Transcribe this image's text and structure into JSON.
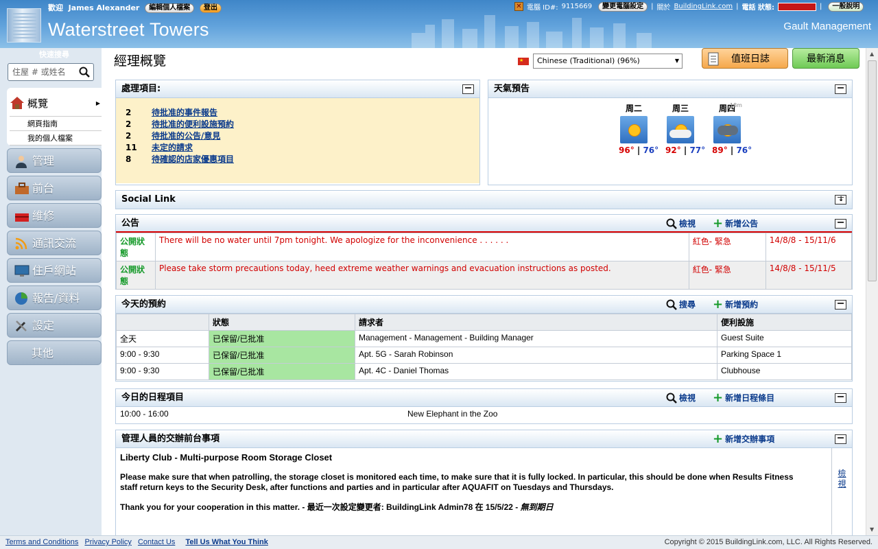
{
  "header": {
    "welcome": "歡迎",
    "user_name": "James Alexander",
    "edit_profile": "編輯個人檔案",
    "logout": "登出",
    "computer_label": "電腦 ID#:",
    "computer_id": "9115669",
    "change_computer": "變更電腦設定",
    "about_prefix": "關於",
    "about_link": "BuildingLink.com",
    "phone_status": "電話 狀態:",
    "general_help": "一般說明",
    "site_title": "Waterstreet Towers",
    "management": "Gault Management"
  },
  "sidebar": {
    "quick_search_label": "快速搜尋",
    "search_placeholder": "住屋 # 或姓名",
    "active_item": "概覽",
    "active_sub": [
      "網頁指南",
      "我的個人檔案"
    ],
    "items": [
      "管理",
      "前台",
      "維修",
      "通訊交流",
      "住戶網站",
      "報告/資料",
      "設定",
      "其他"
    ]
  },
  "main": {
    "page_title": "經理概覽",
    "language": "Chinese (Traditional) (96%)",
    "duty_log": "值班日誌",
    "latest_news": "最新消息"
  },
  "todo": {
    "title": "處理項目:",
    "items": [
      {
        "count": "2",
        "label": "待批准的事件報告"
      },
      {
        "count": "2",
        "label": "待批准的便利設施預約"
      },
      {
        "count": "2",
        "label": "待批准的公告/意見"
      },
      {
        "count": "11",
        "label": "未定的請求"
      },
      {
        "count": "8",
        "label": "待確認的店家優惠項目"
      }
    ]
  },
  "weather": {
    "title": "天氣預告",
    "age": "18m",
    "days": [
      {
        "day": "周二",
        "hi": "96°",
        "lo": "76°"
      },
      {
        "day": "周三",
        "hi": "92°",
        "lo": "77°"
      },
      {
        "day": "周四",
        "hi": "89°",
        "lo": "76°"
      }
    ]
  },
  "social": {
    "title": "Social Link"
  },
  "announcements": {
    "title": "公告",
    "view": "檢視",
    "add": "新增公告",
    "rows": [
      {
        "status": "公開狀態",
        "message": "There will be no water until 7pm tonight. We apologize for the inconvenience . . . . . .",
        "level": "紅色- 緊急",
        "dates": "14/8/8 - 15/11/6"
      },
      {
        "status": "公開狀態",
        "message": "Please take storm precautions today, heed extreme weather warnings and evacuation instructions as posted.",
        "level": "紅色- 緊急",
        "dates": "14/8/8 - 15/11/5"
      }
    ]
  },
  "reservations": {
    "title": "今天的預約",
    "search": "搜尋",
    "add": "新增預約",
    "headers": [
      "",
      "狀態",
      "請求者",
      "便利設施"
    ],
    "rows": [
      {
        "time": "全天",
        "status": "已保留/已批准",
        "requester": "Management - Management - Building Manager",
        "amenity": "Guest Suite"
      },
      {
        "time": "9:00 - 9:30",
        "status": "已保留/已批准",
        "requester": "Apt. 5G - Sarah Robinson",
        "amenity": "Parking Space 1"
      },
      {
        "time": "9:00 - 9:30",
        "status": "已保留/已批准",
        "requester": "Apt. 4C - Daniel Thomas",
        "amenity": "Clubhouse"
      }
    ]
  },
  "schedule": {
    "title": "今日的日程項目",
    "view": "檢視",
    "add": "新增日程條目",
    "rows": [
      {
        "time": "10:00 - 16:00",
        "event": "New Elephant in the Zoo"
      }
    ]
  },
  "notes": {
    "title": "管理人員的交辦前台事項",
    "add": "新增交辦事項",
    "item_title": "Liberty Club - Multi-purpose Room Storage Closet",
    "body": "Please make sure that when patrolling, the storage closet is monitored each time, to make sure that it is fully locked. In particular, this should be done when Results Fitness staff return keys to the Security Desk, after functions and parties and in particular after AQUAFIT on Tuesdays and Thursdays.",
    "thanks": "Thank you for your cooperation in this matter. - 最近一次設定變更者: BuildingLink Admin78 在 15/5/22 -",
    "no_expiry": "無到期日",
    "view": "檢視"
  },
  "footer": {
    "links": [
      "Terms and Conditions",
      "Privacy Policy",
      "Contact Us",
      "Tell Us What You Think"
    ],
    "copyright": "Copyright © 2015 BuildingLink.com, LLC.   All Rights Reserved."
  }
}
